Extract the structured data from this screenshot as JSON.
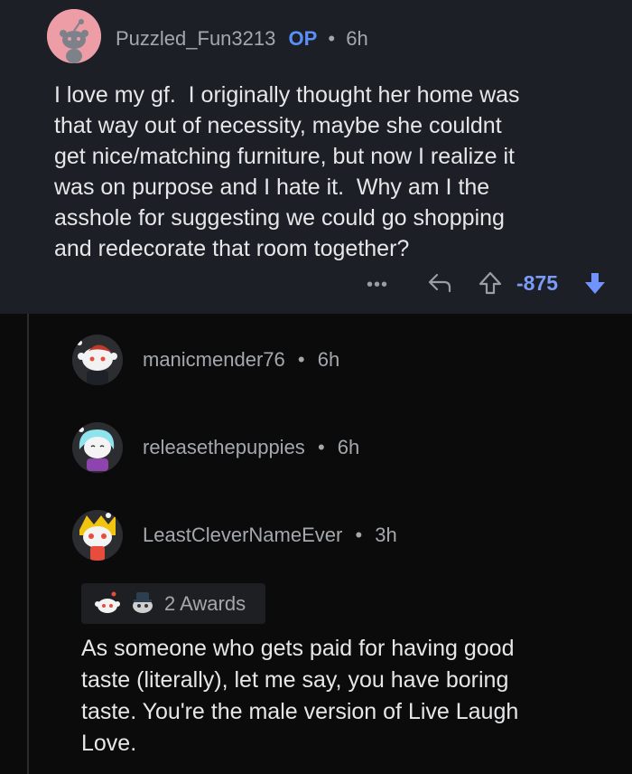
{
  "op_post": {
    "username": "Puzzled_Fun3213",
    "badge": "OP",
    "separator": "•",
    "time": "6h",
    "body": "I love my gf.  I originally thought her home was\nthat way out of necessity, maybe she couldnt\nget nice/matching furniture, but now I realize it\nwas on purpose and I hate it.  Why am I the\nasshole for suggesting we could go shopping\nand redecorate that room together?",
    "actions": {
      "more_label": "•••",
      "score": "-875",
      "icons": [
        "more-icon",
        "reply-icon",
        "upvote-icon",
        "downvote-icon"
      ]
    }
  },
  "comments": [
    {
      "username": "manicmender76",
      "separator": "•",
      "time": "6h"
    },
    {
      "username": "releasethepuppies",
      "separator": "•",
      "time": "6h"
    },
    {
      "username": "LeastCleverNameEver",
      "separator": "•",
      "time": "3h",
      "awards_label": "2 Awards",
      "body": "As someone who gets paid for having good\ntaste (literally), let me say, you have boring\ntaste. You're the male version of Live Laugh\nLove."
    }
  ],
  "colors": {
    "op_background": "#1c1f26",
    "page_background": "#0b0b0c",
    "op_badge": "#5a8ff7",
    "score": "#7a9cf8",
    "downvote_active": "#7193ff"
  }
}
